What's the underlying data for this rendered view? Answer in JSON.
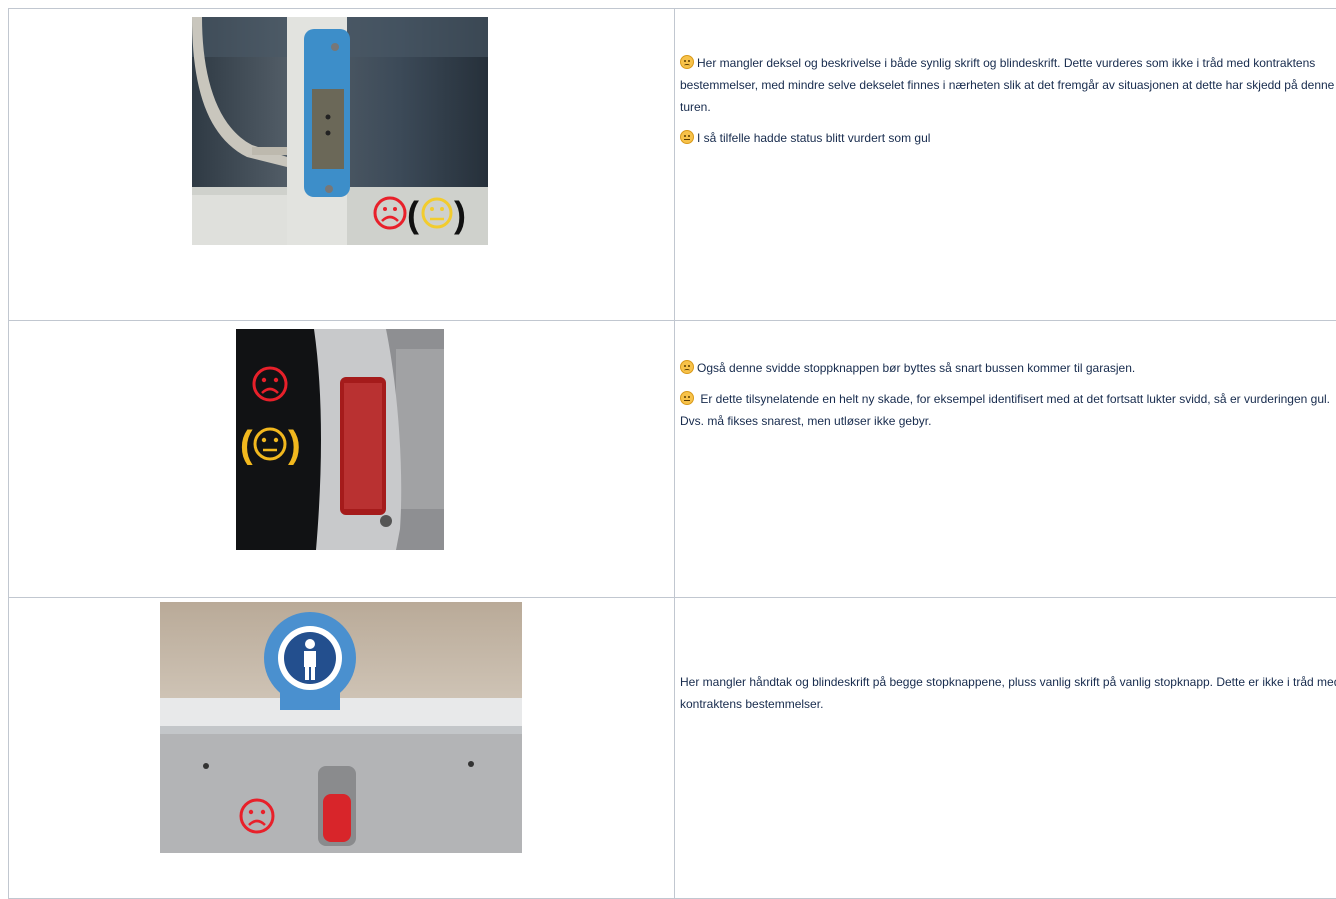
{
  "rows": [
    {
      "paragraphs": [
        {
          "icon": "sad-face-icon",
          "text": "Her mangler deksel og beskrivelse i både synlig skrift og blindeskrift. Dette vurderes som ikke i tråd med kontraktens bestemmelser, med mindre selve dekselet finnes i nærheten slik at det fremgår av situasjonen at dette har skjedd på denne turen."
        },
        {
          "icon": "neutral-face-icon",
          "text": "I så tilfelle hadde status blitt vurdert som gul"
        }
      ]
    },
    {
      "paragraphs": [
        {
          "icon": "sad-face-icon",
          "text": "Også denne svidde stoppknappen bør byttes så snart bussen kommer til garasjen."
        },
        {
          "icon": "neutral-face-icon",
          "text": " Er dette tilsynelatende en helt ny skade, for eksempel identifisert med at det fortsatt lukter svidd, så er vurderingen gul. Dvs. må fikses snarest, men utløser ikke gebyr."
        }
      ]
    },
    {
      "paragraphs": [
        {
          "icon": null,
          "text": "Her mangler håndtak og blindeskrift på begge stopknappene, pluss vanlig skrift på vanlig stopknapp. Dette er ikke i tråd med kontraktens bestemmelser."
        }
      ]
    }
  ],
  "photo_overlays": {
    "row1": {
      "sad_color": "#e8202a",
      "neutral_color": "#f2cc2e"
    },
    "row2": {
      "sad_color": "#e8202a",
      "neutral_color": "#f2b81e"
    },
    "row3": {
      "sad_color": "#e8202a"
    }
  }
}
